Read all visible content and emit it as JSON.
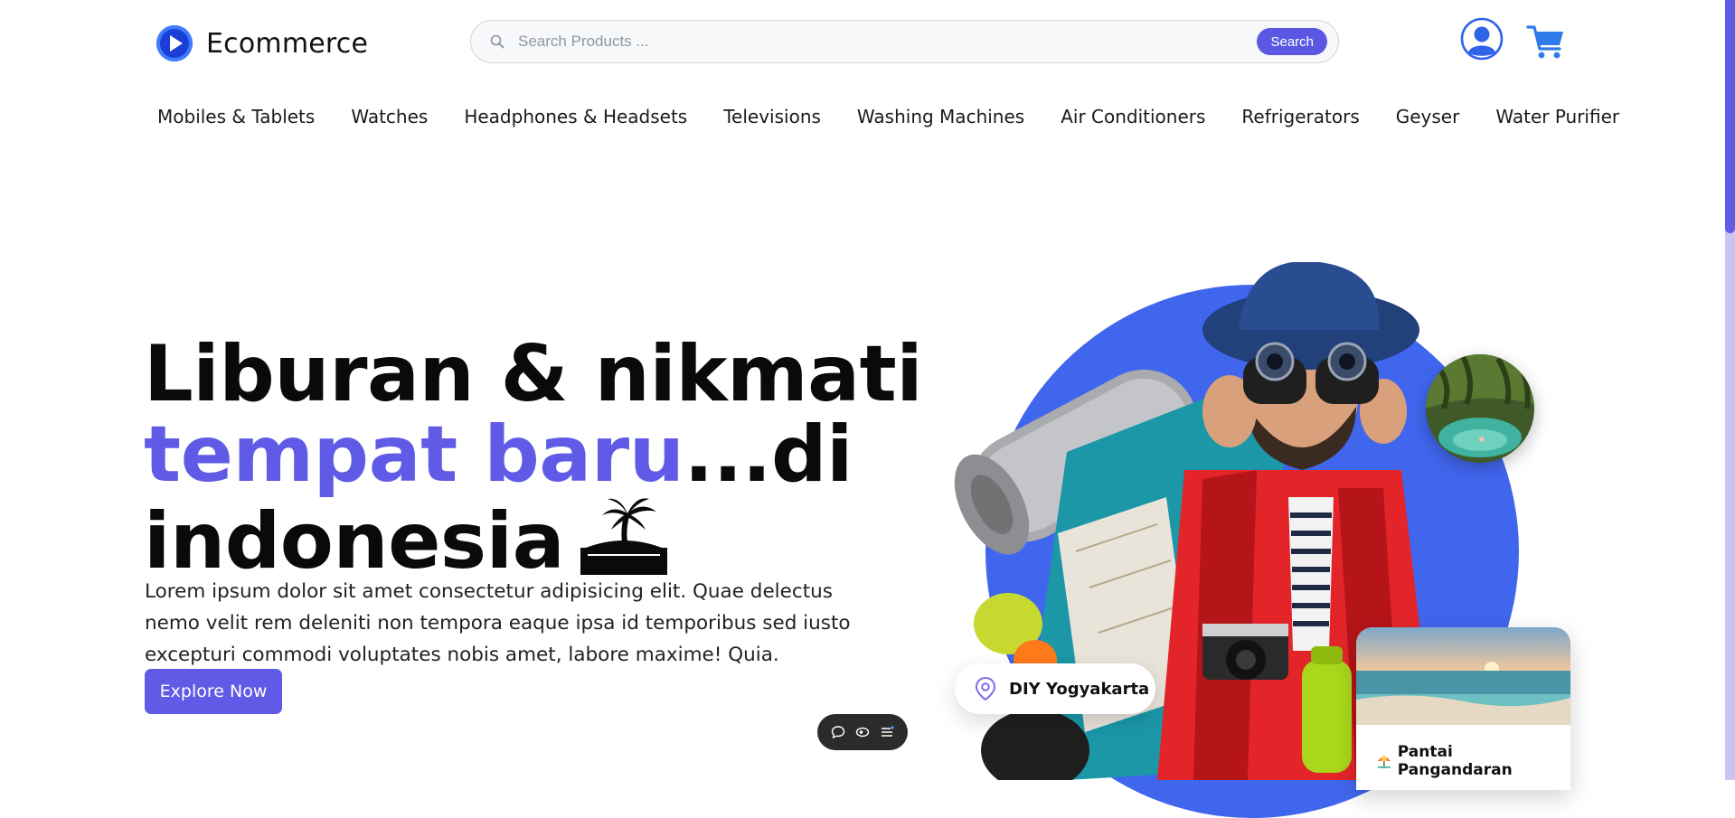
{
  "brand": {
    "name": "Ecommerce",
    "logo_icon": "play-circle-icon"
  },
  "search": {
    "placeholder": "Search Products ...",
    "button_label": "Search"
  },
  "header_icons": {
    "user": "user-icon",
    "cart": "cart-icon"
  },
  "categories": [
    "Mobiles & Tablets",
    "Watches",
    "Headphones & Headsets",
    "Televisions",
    "Washing Machines",
    "Air Conditioners",
    "Refrigerators",
    "Geyser",
    "Water Purifier"
  ],
  "hero": {
    "title_line1": "Liburan & nikmati",
    "title_accent": "tempat baru",
    "title_line2_rest": "...di",
    "title_line3": "indonesia",
    "description": "Lorem ipsum dolor sit amet consectetur adipisicing elit. Quae delectus nemo velit rem deleniti non tempora eaque ipsa id temporibus sed iusto excepturi commodi voluptates nobis amet, labore maxime! Quia.",
    "cta_label": "Explore Now",
    "location_chip": "DIY Yogyakarta",
    "beach_card_label": "Pantai Pangandaran"
  },
  "colors": {
    "accent": "#5f5be6",
    "hero_circle": "#4066ee",
    "text": "#0a0a0a"
  }
}
